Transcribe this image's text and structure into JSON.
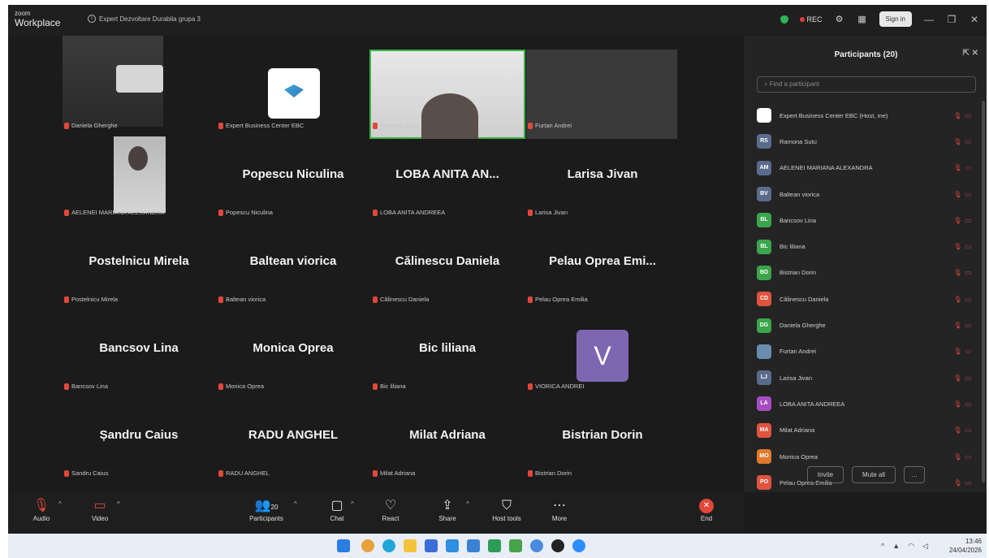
{
  "window": {
    "brand_top": "zoom",
    "brand_bottom": "Workplace",
    "meeting_title": "Expert Dezvoltare Durabila grupa 3",
    "rec_label": "REC",
    "signin_label": "Sign in"
  },
  "gallery": {
    "tiles": [
      {
        "big": "",
        "label": "Daniela Gherghe"
      },
      {
        "big": "",
        "label": "Expert Business Center EBC"
      },
      {
        "big": "",
        "label": "Ramona Sutu"
      },
      {
        "big": "",
        "label": "Furtan Andrei"
      },
      {
        "big": "",
        "label": "AELENEI MARIANA ALEXANDRA"
      },
      {
        "big": "Popescu Niculina",
        "label": "Popescu Niculina"
      },
      {
        "big": "LOBA ANITA AN...",
        "label": "LOBA ANITA ANDREEA"
      },
      {
        "big": "Larisa Jivan",
        "label": "Larisa Jivan"
      },
      {
        "big": "Postelnicu Mirela",
        "label": "Postelnicu Mirela"
      },
      {
        "big": "Baltean viorica",
        "label": "Baltean viorica"
      },
      {
        "big": "Călinescu Daniela",
        "label": "Călinescu Daniela"
      },
      {
        "big": "Pelau Oprea Emi...",
        "label": "Pelau Oprea Emilia"
      },
      {
        "big": "Bancsov Lina",
        "label": "Bancsov Lina"
      },
      {
        "big": "Monica Oprea",
        "label": "Monica Oprea"
      },
      {
        "big": "Bic liliana",
        "label": "Bic liliana"
      },
      {
        "big": "",
        "label": "VIORICA ANDREI"
      },
      {
        "big": "Șandru Caius",
        "label": "Sandru Caius"
      },
      {
        "big": "RADU ANGHEL",
        "label": "RADU ANGHEL"
      },
      {
        "big": "Milat Adriana",
        "label": "Milat Adriana"
      },
      {
        "big": "Bistrian Dorin",
        "label": "Bistrian Dorin"
      }
    ],
    "v_avatar": "V"
  },
  "participants": {
    "title": "Participants (20)",
    "search_placeholder": "Find a participant",
    "items": [
      {
        "initials": "",
        "name": "Expert Business Center EBC (Host, me)",
        "color": "#ffffff"
      },
      {
        "initials": "RS",
        "name": "Ramona Sutu",
        "color": "#5a6b8c"
      },
      {
        "initials": "AM",
        "name": "AELENEI MARIANA ALEXANDRA",
        "color": "#5a6b8c"
      },
      {
        "initials": "BV",
        "name": "Baltean viorica",
        "color": "#5a6b8c"
      },
      {
        "initials": "BL",
        "name": "Bancsov Lina",
        "color": "#3aa54a"
      },
      {
        "initials": "BL",
        "name": "Bic liliana",
        "color": "#3aa54a"
      },
      {
        "initials": "BD",
        "name": "Bistrian Dorin",
        "color": "#3aa54a"
      },
      {
        "initials": "CD",
        "name": "Călinescu Daniela",
        "color": "#e0533d"
      },
      {
        "initials": "DG",
        "name": "Daniela Gherghe",
        "color": "#3aa54a"
      },
      {
        "initials": "",
        "name": "Furtan Andrei",
        "color": "#6a8caf"
      },
      {
        "initials": "LJ",
        "name": "Larisa Jivan",
        "color": "#5a6b8c"
      },
      {
        "initials": "LA",
        "name": "LOBA ANITA ANDREEA",
        "color": "#a64dbf"
      },
      {
        "initials": "MA",
        "name": "Milat Adriana",
        "color": "#e0533d"
      },
      {
        "initials": "MO",
        "name": "Monica Oprea",
        "color": "#e07a2d"
      },
      {
        "initials": "PO",
        "name": "Pelau Oprea Emilia",
        "color": "#e0533d"
      }
    ],
    "invite_label": "Invite",
    "mute_all_label": "Mute all"
  },
  "toolbar": {
    "audio": "Audio",
    "video": "Video",
    "participants": "Participants",
    "participants_count": "20",
    "chat": "Chat",
    "react": "React",
    "share": "Share",
    "host_tools": "Host tools",
    "more": "More",
    "end": "End"
  },
  "taskbar": {
    "time": "13:46",
    "date": "24/04/2026"
  }
}
